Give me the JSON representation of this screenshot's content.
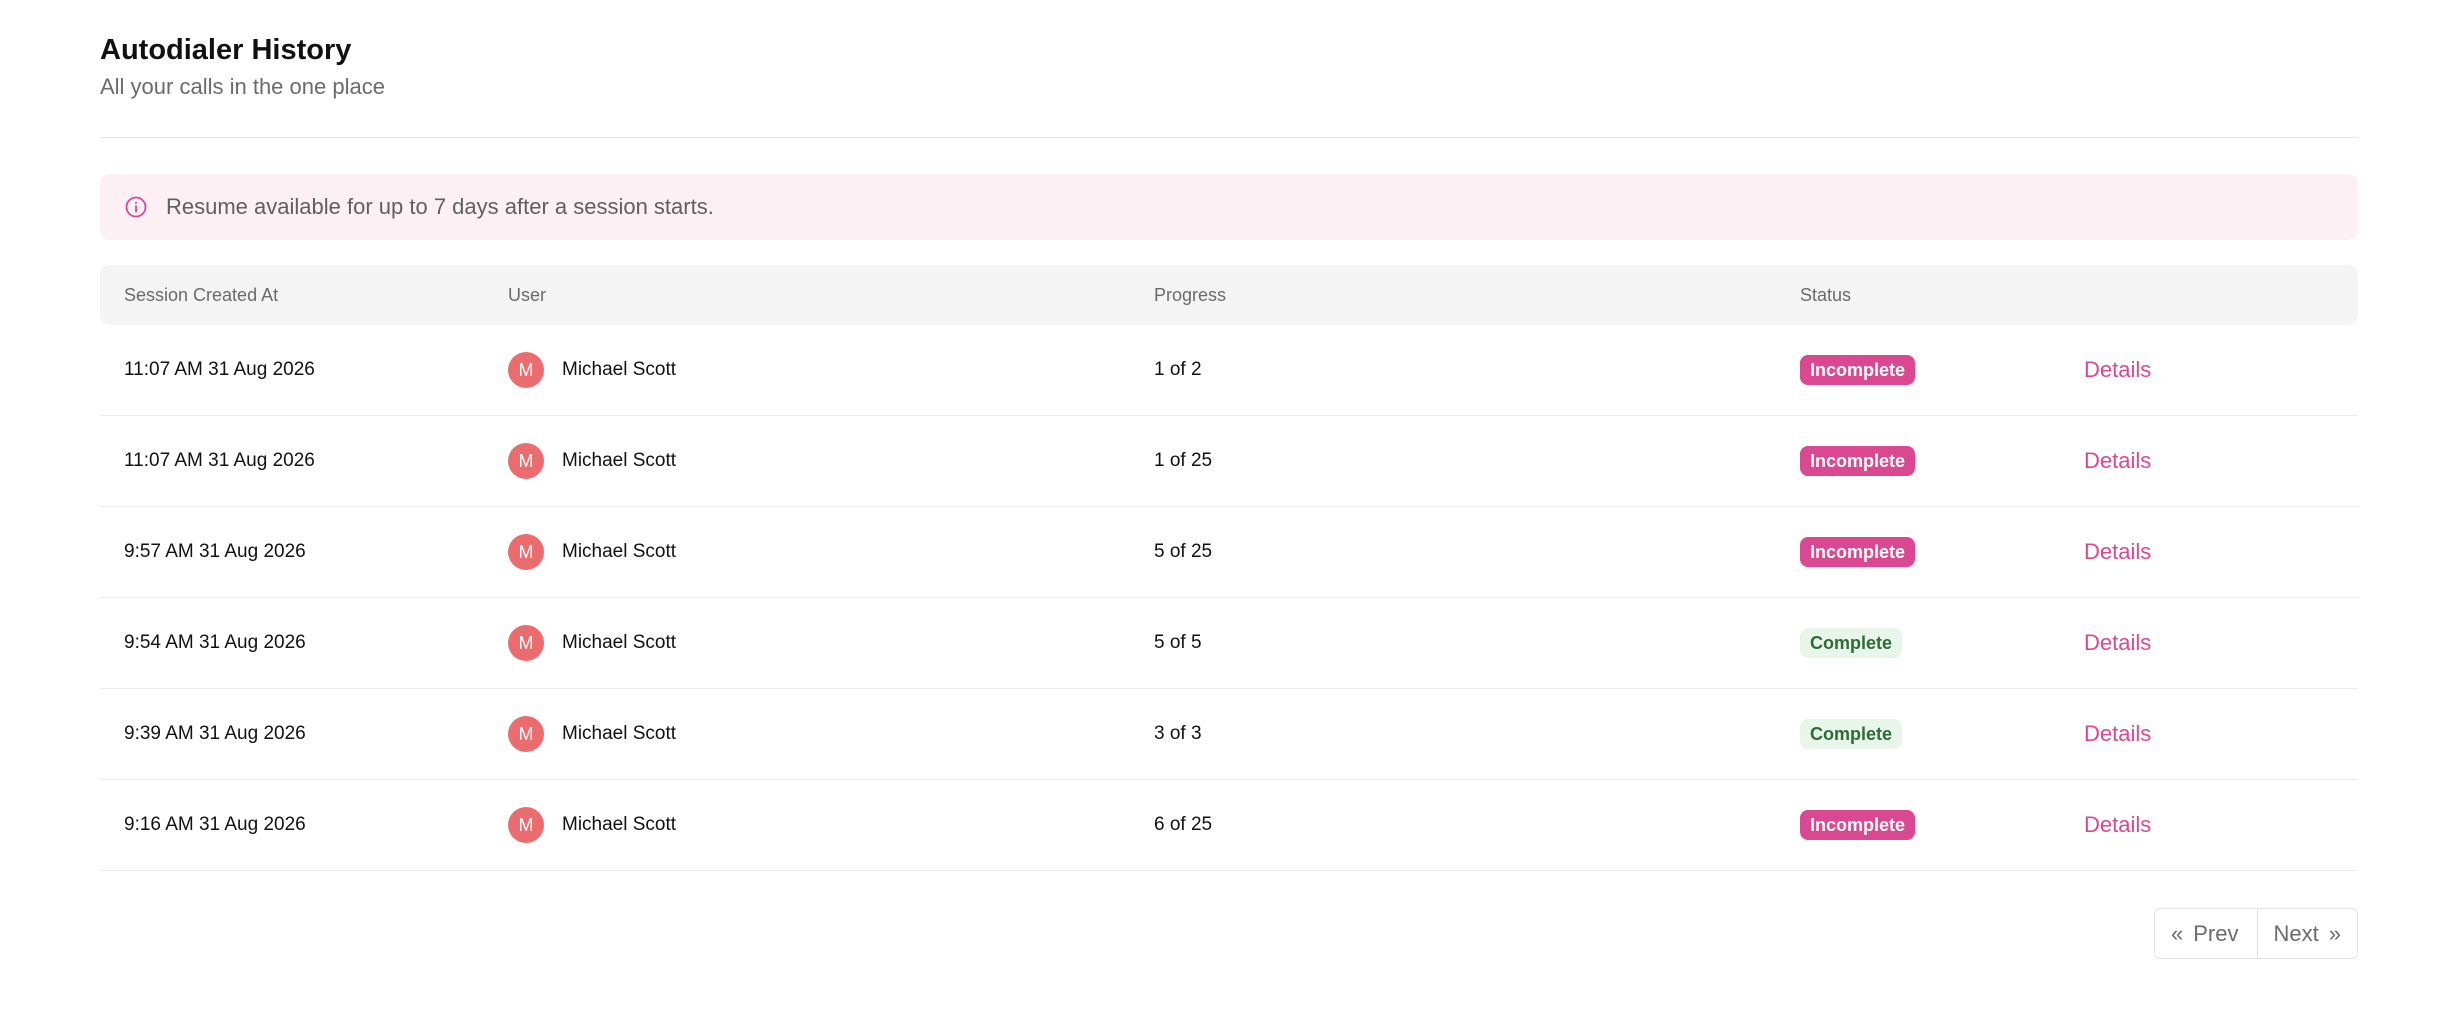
{
  "header": {
    "title": "Autodialer History",
    "subtitle": "All your calls in the one place"
  },
  "alert": {
    "icon": "info-icon",
    "text": "Resume available for up to 7 days after a session starts."
  },
  "table": {
    "columns": [
      "Session Created At",
      "User",
      "Progress",
      "Status"
    ],
    "rows": [
      {
        "created": "11:07 AM 31 Aug 2026",
        "avatar": "M",
        "user": "Michael Scott",
        "progress": "1 of 2",
        "status": "Incomplete",
        "action": "Details"
      },
      {
        "created": "11:07 AM 31 Aug 2026",
        "avatar": "M",
        "user": "Michael Scott",
        "progress": "1 of 25",
        "status": "Incomplete",
        "action": "Details"
      },
      {
        "created": "9:57 AM 31 Aug 2026",
        "avatar": "M",
        "user": "Michael Scott",
        "progress": "5 of 25",
        "status": "Incomplete",
        "action": "Details"
      },
      {
        "created": "9:54 AM 31 Aug 2026",
        "avatar": "M",
        "user": "Michael Scott",
        "progress": "5 of 5",
        "status": "Complete",
        "action": "Details"
      },
      {
        "created": "9:39 AM 31 Aug 2026",
        "avatar": "M",
        "user": "Michael Scott",
        "progress": "3 of 3",
        "status": "Complete",
        "action": "Details"
      },
      {
        "created": "9:16 AM 31 Aug 2026",
        "avatar": "M",
        "user": "Michael Scott",
        "progress": "6 of 25",
        "status": "Incomplete",
        "action": "Details"
      }
    ]
  },
  "pagination": {
    "prev_label": "Prev",
    "next_label": "Next",
    "prev_icon": "chevrons-left-icon",
    "next_icon": "chevrons-right-icon"
  },
  "colors": {
    "accent": "#d94890",
    "alert_bg": "#fcf0f5",
    "avatar_bg": "#ea6c6e",
    "complete_bg": "#e8f6ea",
    "complete_text": "#2e6b38"
  }
}
